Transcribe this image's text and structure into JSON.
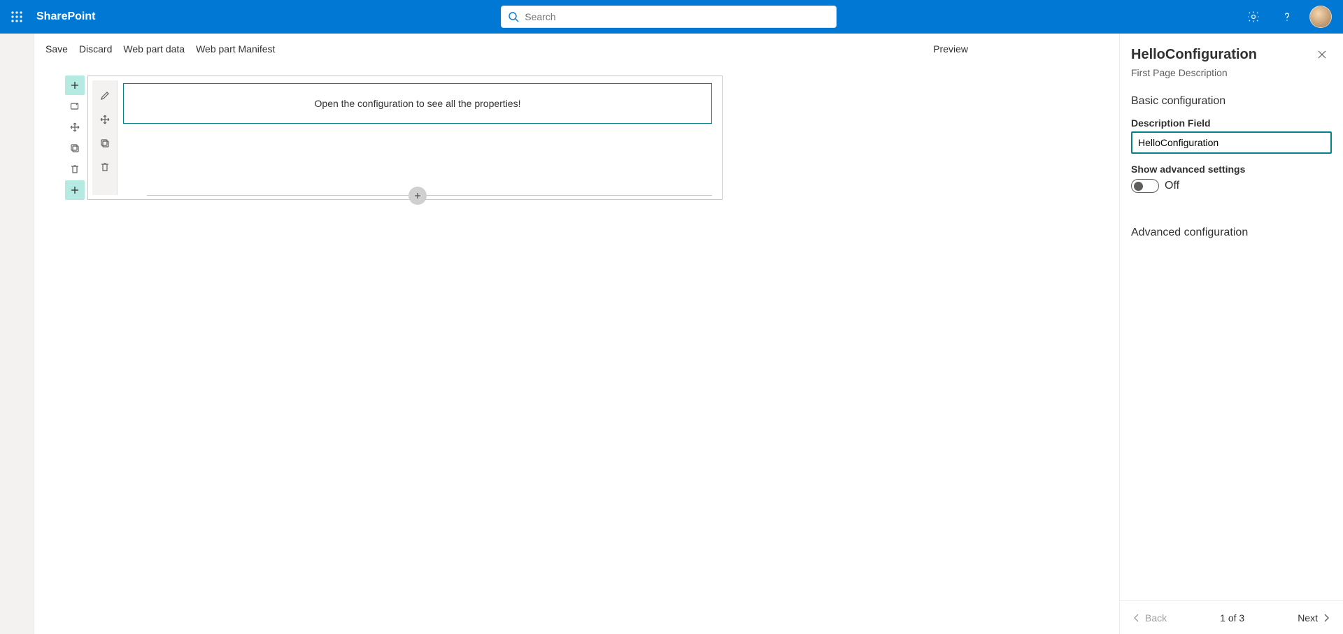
{
  "suite": {
    "app_name": "SharePoint",
    "search_placeholder": "Search"
  },
  "commands": {
    "save": "Save",
    "discard": "Discard",
    "webpart_data": "Web part data",
    "webpart_manifest": "Web part Manifest",
    "preview": "Preview"
  },
  "canvas": {
    "webpart_message": "Open the configuration to see all the properties!"
  },
  "panel": {
    "title": "HelloConfiguration",
    "subtitle": "First Page Description",
    "group_basic": "Basic configuration",
    "description_field_label": "Description Field",
    "description_field_value": "HelloConfiguration",
    "show_advanced_label": "Show advanced settings",
    "toggle_state": "Off",
    "group_advanced": "Advanced configuration",
    "back_label": "Back",
    "next_label": "Next",
    "page_indicator": "1 of 3"
  }
}
